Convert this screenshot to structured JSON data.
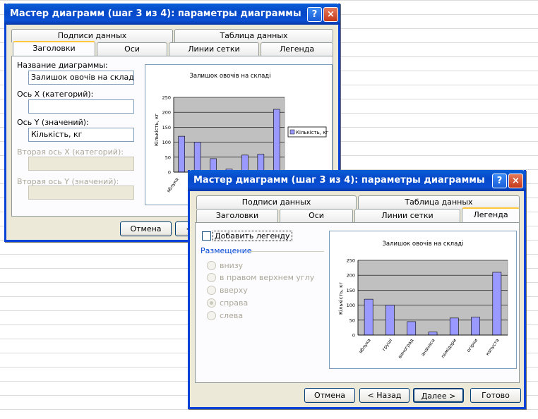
{
  "dialog_back": {
    "title": "Мастер диаграмм (шаг 3 из 4): параметры диаграммы",
    "help_glyph": "?",
    "close_glyph": "×",
    "tabs_row1": [
      "Подписи данных",
      "Таблица данных"
    ],
    "tabs_row2": [
      "Заголовки",
      "Оси",
      "Линии сетки",
      "Легенда"
    ],
    "active_tab": "Заголовки",
    "fields": {
      "chart_title_label": "Название диаграммы:",
      "chart_title_value": "Залишок овочів на складі",
      "x_axis_label": "Ось X (категорий):",
      "x_axis_value": "",
      "y_axis_label": "Ось Y (значений):",
      "y_axis_value": "Кількість, кг",
      "x2_axis_label": "Вторая ось X (категорий):",
      "y2_axis_label": "Вторая ось Y (значений):"
    },
    "buttons": {
      "cancel": "Отмена",
      "back_partial": "<"
    },
    "legend_text": "Кількість, кг",
    "visible_category": "яблука"
  },
  "dialog_front": {
    "title": "Мастер диаграмм (шаг 3 из 4): параметры диаграммы",
    "help_glyph": "?",
    "close_glyph": "×",
    "tabs_row1": [
      "Подписи данных",
      "Таблица данных"
    ],
    "tabs_row2": [
      "Заголовки",
      "Оси",
      "Линии сетки",
      "Легенда"
    ],
    "active_tab": "Легенда",
    "add_legend_label": "Добавить легенду",
    "add_legend_checked": false,
    "placement_label": "Размещение",
    "placement_options": [
      "внизу",
      "в правом верхнем углу",
      "вверху",
      "справа",
      "слева"
    ],
    "placement_selected": "справа",
    "placement_enabled": false,
    "buttons": {
      "cancel": "Отмена",
      "back": "< Назад",
      "next": "Далее >",
      "finish": "Готово"
    }
  },
  "chart_data": {
    "type": "bar",
    "title": "Залишок овочів на складі",
    "ylabel": "Кількість, кг",
    "xlabel": "",
    "categories": [
      "яблука",
      "груші",
      "виноград",
      "ананаси",
      "помідори",
      "огірки",
      "капуста"
    ],
    "values": [
      120,
      100,
      45,
      10,
      57,
      60,
      210
    ],
    "ylim": [
      0,
      250
    ],
    "yticks": [
      0,
      50,
      100,
      150,
      200,
      250
    ],
    "grid": true,
    "bar_color": "#9999ff",
    "plot_bg": "#c0c0c0"
  },
  "colors": {
    "title_bar": "#0a4fd4",
    "dialog_bg": "#ece9d8",
    "group_label": "#0046d5"
  }
}
